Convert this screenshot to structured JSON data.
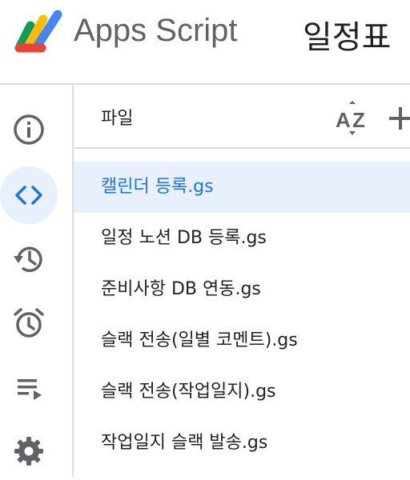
{
  "header": {
    "app_name": "Apps Script",
    "project_title": "일정표"
  },
  "rail": {
    "items": [
      {
        "icon": "info-icon",
        "active": false
      },
      {
        "icon": "code-icon",
        "active": true
      },
      {
        "icon": "history-icon",
        "active": false
      },
      {
        "icon": "alarm-icon",
        "active": false
      },
      {
        "icon": "playlist-icon",
        "active": false
      },
      {
        "icon": "gear-icon",
        "active": false
      }
    ]
  },
  "files": {
    "title": "파일",
    "sort_icon": "sort-az-icon",
    "add_icon": "plus-icon",
    "items": [
      {
        "name": "캘린더 등록.gs",
        "selected": true
      },
      {
        "name": "일정 노션 DB 등록.gs",
        "selected": false
      },
      {
        "name": "준비사항 DB 연동.gs",
        "selected": false
      },
      {
        "name": "슬랙 전송(일별 코멘트).gs",
        "selected": false
      },
      {
        "name": "슬랙 전송(작업일지).gs",
        "selected": false
      },
      {
        "name": "작업일지 슬랙 발송.gs",
        "selected": false
      }
    ]
  },
  "colors": {
    "accent": "#1a73e8",
    "selected_bg": "#e8f0fe",
    "icon": "#5f6368",
    "divider": "#dadce0"
  }
}
